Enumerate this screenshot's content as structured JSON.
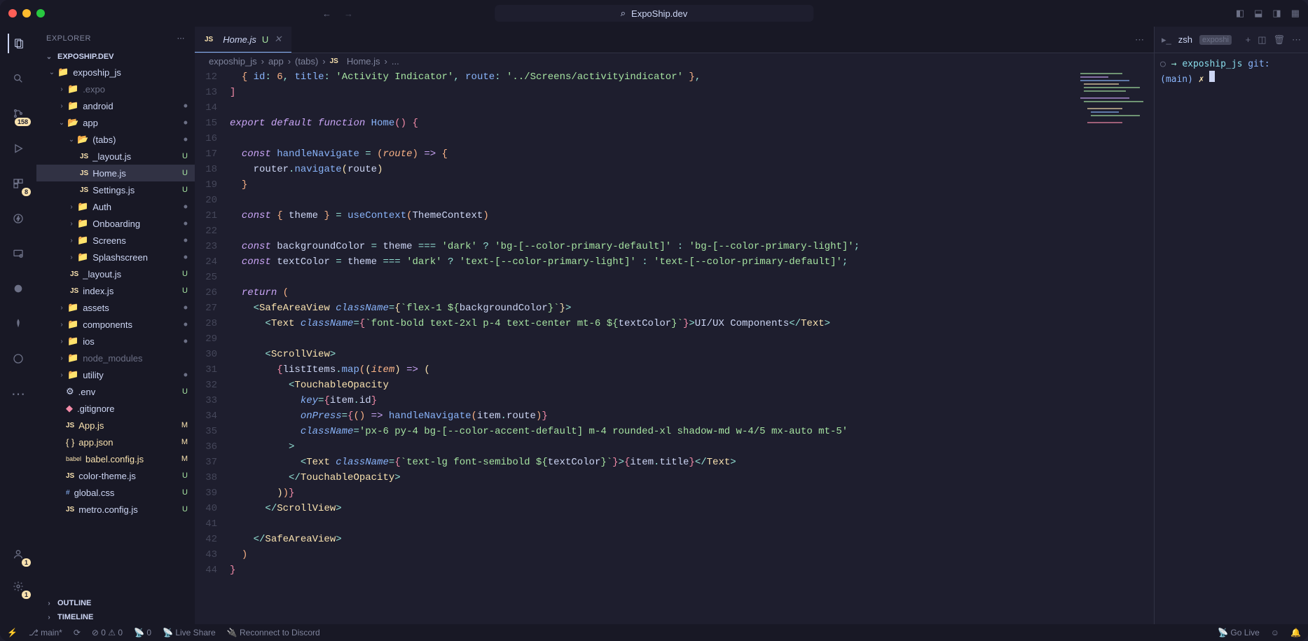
{
  "title": "ExpoShip.dev",
  "explorer": {
    "title": "EXPLORER",
    "project": "EXPOSHIP.DEV",
    "outline": "OUTLINE",
    "timeline": "TIMELINE"
  },
  "tree": {
    "root": "expoship_js",
    "expo": ".expo",
    "android": "android",
    "app": "app",
    "tabs": "(tabs)",
    "layout": "_layout.js",
    "home": "Home.js",
    "settings": "Settings.js",
    "auth": "Auth",
    "onboarding": "Onboarding",
    "screens": "Screens",
    "splash": "Splashscreen",
    "layout2": "_layout.js",
    "index": "index.js",
    "assets": "assets",
    "components": "components",
    "ios": "ios",
    "node_modules": "node_modules",
    "utility": "utility",
    "env": ".env",
    "gitignore": ".gitignore",
    "appjs": "App.js",
    "appjson": "app.json",
    "babel": "babel.config.js",
    "colortheme": "color-theme.js",
    "globalcss": "global.css",
    "metro": "metro.config.js"
  },
  "tab": {
    "file": "Home.js",
    "status": "U"
  },
  "breadcrumb": {
    "p1": "expoship_js",
    "p2": "app",
    "p3": "(tabs)",
    "p4": "Home.js",
    "p5": "..."
  },
  "lines": [
    "12",
    "13",
    "14",
    "15",
    "16",
    "17",
    "18",
    "19",
    "20",
    "21",
    "22",
    "23",
    "24",
    "25",
    "26",
    "27",
    "28",
    "29",
    "30",
    "31",
    "32",
    "33",
    "34",
    "35",
    "36",
    "37",
    "38",
    "39",
    "40",
    "41",
    "42",
    "43",
    "44"
  ],
  "terminal": {
    "shell": "zsh",
    "label": "exposhi",
    "prompt_dir": "expoship_js",
    "prompt_git": "git:(main)",
    "prompt_x": "✗"
  },
  "status": {
    "branch": "main*",
    "errors": "0",
    "warnings": "0",
    "port": "0",
    "liveshare": "Live Share",
    "discord": "Reconnect to Discord",
    "golive": "Go Live"
  },
  "badges": {
    "scm": "158",
    "ext": "8",
    "acc": "1",
    "gear": "1"
  }
}
